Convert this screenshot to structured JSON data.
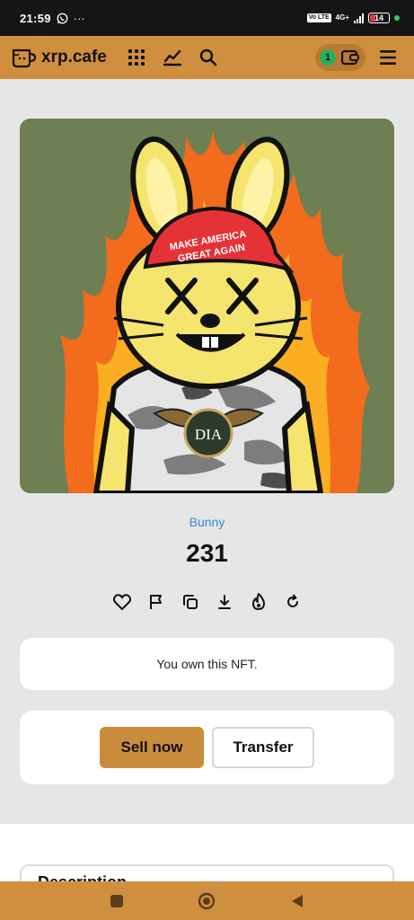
{
  "status_bar": {
    "time": "21:59",
    "more": "···",
    "network": "4G+",
    "volte": "Vo LTE",
    "battery": "14"
  },
  "header": {
    "site_name": "xrp.cafe",
    "wallet_count": "1"
  },
  "nft": {
    "collection": "Bunny",
    "title": "231",
    "hat_text_line1": "MAKE AMERICA",
    "hat_text_line2": "GREAT AGAIN",
    "badge_text": "DIA"
  },
  "ownership": {
    "message": "You own this NFT."
  },
  "buttons": {
    "sell": "Sell now",
    "transfer": "Transfer"
  },
  "description": {
    "heading": "Description"
  },
  "icons": {
    "actions": [
      "heart-icon",
      "flag-icon",
      "copy-icon",
      "download-icon",
      "fire-icon",
      "refresh-icon"
    ]
  },
  "colors": {
    "header_bg": "#d08f3e",
    "sell_button": "#c98d3d",
    "collection_link": "#3b82d8",
    "image_bg": "#6e7f54"
  }
}
